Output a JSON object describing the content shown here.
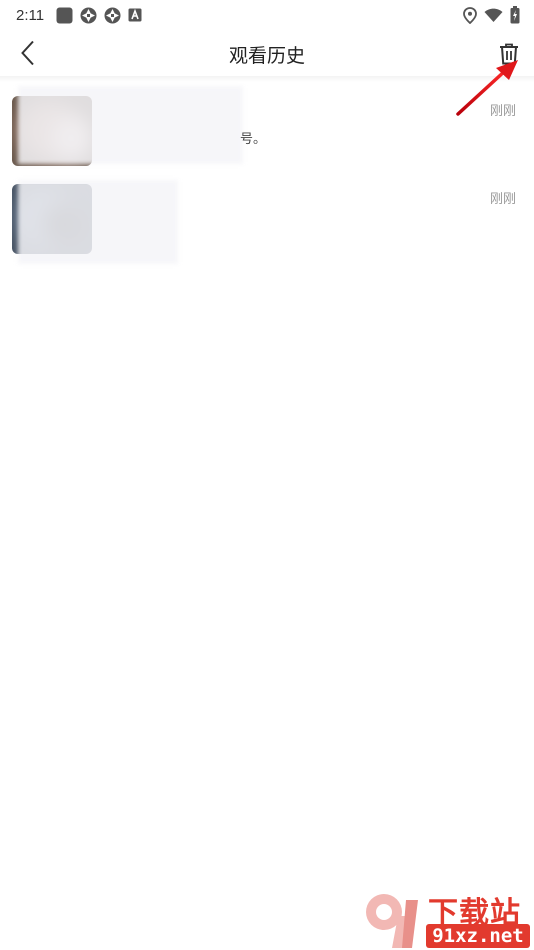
{
  "status_bar": {
    "time": "2:11",
    "left_icons": [
      "app-square-icon",
      "aperture-icon",
      "aperture-icon",
      "a-letter-icon"
    ],
    "right_icons": [
      "location-icon",
      "wifi-icon",
      "battery-charging-icon"
    ]
  },
  "app_bar": {
    "title": "观看历史",
    "back_icon": "chevron-left-icon",
    "delete_icon": "trash-icon"
  },
  "history_items": [
    {
      "desc_tail": "号。",
      "time": "刚刚"
    },
    {
      "desc_tail": "",
      "time": "刚刚"
    }
  ],
  "watermark": {
    "title": "下载站",
    "domain": "91xz.net"
  },
  "colors": {
    "annotation_arrow": "#e0181b",
    "watermark_red": "#e23a2e",
    "time_gray": "#999999"
  }
}
